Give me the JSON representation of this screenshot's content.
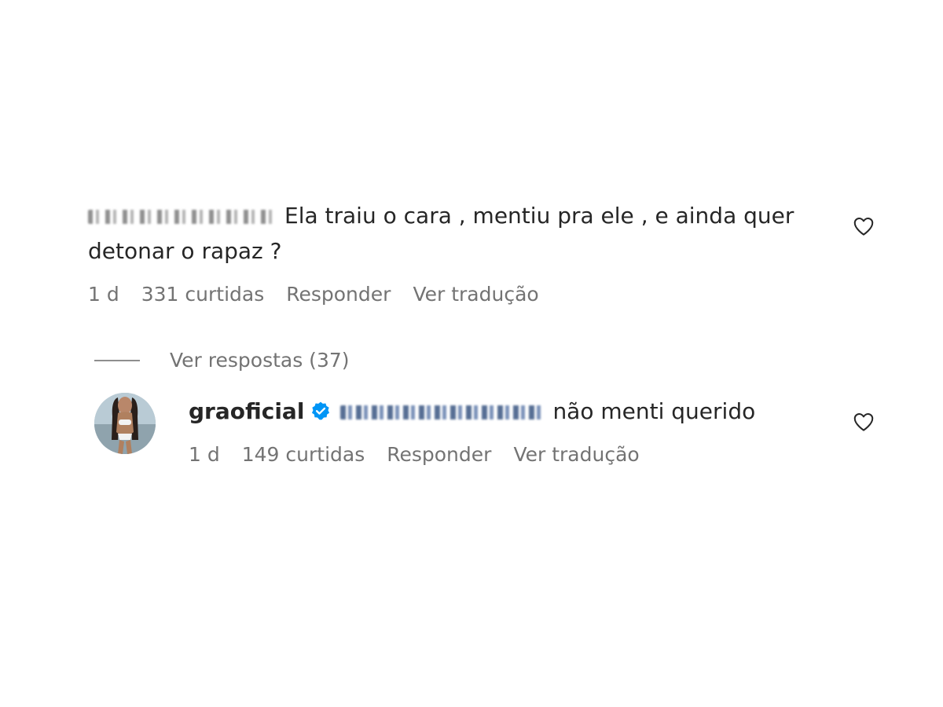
{
  "comment": {
    "text_line": "Ela traiu o cara , mentiu pra ele , e ainda quer detonar o rapaz ?",
    "time": "1 d",
    "likes": "331 curtidas",
    "reply_label": "Responder",
    "translate_label": "Ver tradução"
  },
  "replies_toggle": {
    "label": "Ver respostas (37)"
  },
  "reply": {
    "username": "graoficial",
    "text": "não menti querido",
    "time": "1 d",
    "likes": "149 curtidas",
    "reply_label": "Responder",
    "translate_label": "Ver tradução"
  },
  "icons": {
    "like": "heart-outline-icon",
    "verified": "verified-badge-icon"
  },
  "colors": {
    "text": "#262626",
    "secondary": "#737373",
    "verified": "#0095f6"
  }
}
